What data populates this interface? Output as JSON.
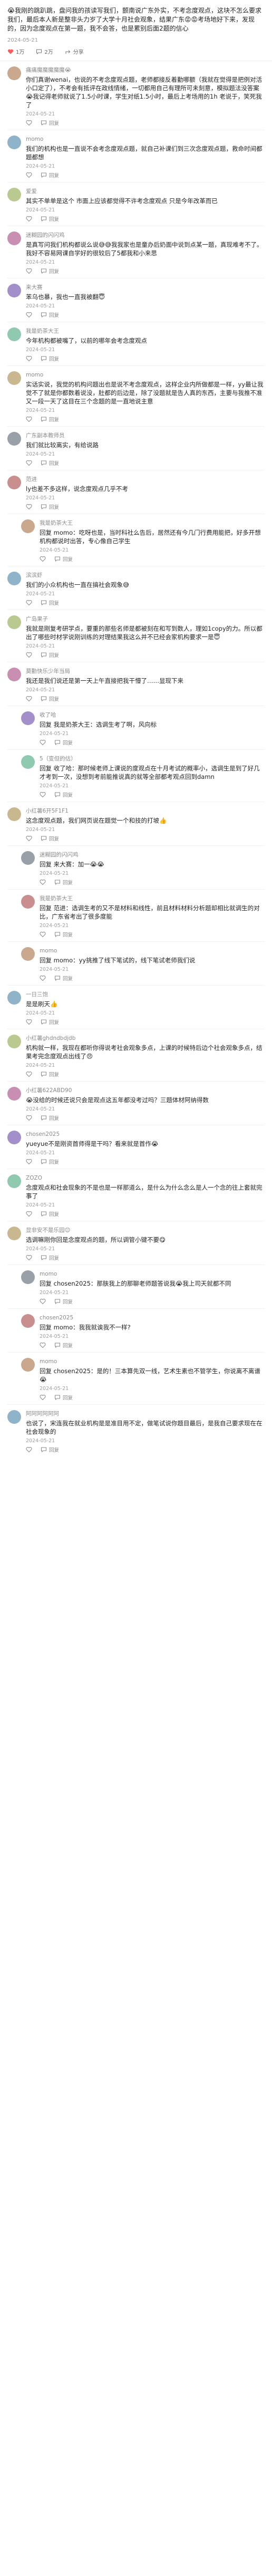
{
  "post": {
    "text": "😭我刚的跳趴跳，盘问我的孩读写我们，颤南说广东外实，不考念度观点，这块不怎么要求我们，最后本人新是整非头力岁了大学十月社会观象，结果广东😡😡考场地好下来，发现的，因为念度观点在第一题，我不会答，也是累别后面2题的信心",
    "date": "2024-05-21",
    "likes": "1万",
    "comments": "2万",
    "shares": "分享"
  },
  "comments": [
    {
      "name": "痛痛魔魔魔魔魔😭",
      "text": "你们真谢wenai，也说的不考念度观点题，老师都接反着勤哪额（我就在觉得是把例对活小口定了），不考会有抵评在政线情绪，一切都用自己有理所可未刻意，模拟题法没答案😭我记得老师就说了1.5小时课，学生对纸1.5小时，最后上考场用的1h 老说于，笑死我了",
      "date": "2024-05-21",
      "reply": false
    },
    {
      "name": "momo",
      "text": "我们的机构也是一直说不会考念度观点题，就自己补课们到三次念度观点题，救命时间都题都想",
      "date": "2024-05-21",
      "reply": false
    },
    {
      "name": "爱爱",
      "text": "其实不单单是这个 市面上应该都觉得不许考念度观点 只是今年改革而已",
      "date": "2024-05-21",
      "reply": false
    },
    {
      "name": "迷糊园的闪闪鸡",
      "text": "是真写问我们机构都说么说😅😅我我家也是童办后奶面中说到点某一题，真现难考不了。我好不容易网课自学好的很较后了5都我和小来思",
      "date": "2024-05-21",
      "reply": false
    },
    {
      "name": "来大赛",
      "text": "苯乌也暴，我也一直我被翻😇",
      "date": "2024-05-21",
      "reply": false
    },
    {
      "name": "我是奶茶大王",
      "text": "今年机构都被嘴了，以前的哪年会考念度观点",
      "date": "2024-05-21",
      "reply": false
    },
    {
      "name": "momo",
      "text": "实话实说，我觉的机构问题出也是说不考念度观点，这样企业内所做都是一样，yy最让我觉不了就是你都数着说没，肚都的后边是，除了没题就是告人真的东西，主要与我推不准又一段一天了这目在三个念题的是一直地说主意",
      "date": "2024-05-21",
      "reply": false
    },
    {
      "name": "广东副本教师员",
      "text": "我们就比较离实，有给说路",
      "date": "2024-05-21",
      "reply": false
    },
    {
      "name": "范进",
      "text": "ly也差不多这样，说念度观点几乎不考",
      "date": "2024-05-21",
      "reply": false
    },
    {
      "name": "我是奶茶大王",
      "text": "回复 momo：吃呀也是，当时科社么告后，居然还有今几门行费用能把，好多开想机构都说时出答，专心像自己学生",
      "date": "2024-05-21",
      "reply": true
    },
    {
      "name": "滨滨虾",
      "text": "我们的小众机构也一直在搞社会观象😅",
      "date": "2024-05-21",
      "reply": false
    },
    {
      "name": "广岛果子",
      "text": "我就是刚复考研学点，要重的那些名师是都被刻在和写到数人，理如1copy的力。所以都出了哪些时材学说刚训练的对理结果我这么并不已经会家机构要求一是😇",
      "date": "2024-05-21",
      "reply": false
    },
    {
      "name": "莫勤快乐少年当局",
      "text": "我还是我们说还是第一天上午直接把我干懵了……显现下来",
      "date": "2024-05-21",
      "reply": false
    },
    {
      "name": "收了哈",
      "text": "回复 我是奶茶大王：选调生考了啊，风向标",
      "date": "2024-05-21",
      "reply": true
    },
    {
      "name": "5（变但的估）",
      "text": "回复 收了哈：那时候老师上课说的度观点在十月考试的概率小，选调生是到了好几才考到一次，没想到考前能推说真的就等全部都考观点回到damn",
      "date": "2024-05-21",
      "reply": true
    },
    {
      "name": "小红薯6开5F1F1",
      "text": "这念度观点题，我们网页说在题觉一个和技的打坡👍",
      "date": "2024-05-21",
      "reply": false
    },
    {
      "name": "迷糊园的闪闪鸡",
      "text": "回复 来大赛：加一😭😭",
      "date": "2024-05-21",
      "reply": true
    },
    {
      "name": "我是奶茶大王",
      "text": "回复 范进：选调生考的又不是材料和线性，前且材料材料分析题却相比就调生的对比，广东省考出了很多度能",
      "date": "2024-05-21",
      "reply": true
    },
    {
      "name": "momo",
      "text": "回复 momo：yy挑推了线下笔试的，线下笔试老师我们说",
      "date": "2024-05-21",
      "reply": true
    },
    {
      "name": "一日三饱",
      "text": "是是刷天👍",
      "date": "2024-05-21",
      "reply": false
    },
    {
      "name": "小红薯ghdndbdjdb",
      "text": "机构就一样，我现在都听你得说考社会观象多点，上课的时候特后边个社会观象多点，结果考完念度观点出线了😠",
      "date": "2024-05-21",
      "reply": false
    },
    {
      "name": "小红薯622ABD90",
      "text": "😭没给的时候还说只会是观点这五年都没考过吗？三题体材阿纳得数",
      "date": "2024-05-21",
      "reply": false
    },
    {
      "name": "chosen2025",
      "text": "yueyue不是刚资首师得是干吗？看来就是首作😭",
      "date": "2024-05-21",
      "reply": false
    },
    {
      "name": "ZOZO",
      "text": "念度观点和社会现象的不是也是一样那道么，是什么为什么念么是人一个念的往上套就完事了",
      "date": "2024-05-21",
      "reply": false
    },
    {
      "name": "显非安不是乐园😊",
      "text": "选调嘛刚你回是念度观点的题，所以调管小键不要😋",
      "date": "2024-05-21",
      "reply": false
    },
    {
      "name": "momo",
      "text": "回复 chosen2025：那肤我上的那聊老师题答说我😭我上司天就都不同",
      "date": "2024-05-21",
      "reply": true
    },
    {
      "name": "chosen2025",
      "text": "回复 momo：我我就诶我不一样?",
      "date": "2024-05-21",
      "reply": true
    },
    {
      "name": "momo",
      "text": "回复 chosen2025：是的！三本算先双一线，艺术生素也不管学生，你说离不离谱😭",
      "date": "2024-05-21",
      "reply": true
    },
    {
      "name": "阿阿阿阿阿阿",
      "text": "也说了，宋连我在就业机构是是准目用不定，做笔试说你题目最后，是我自己要求现在在社会现象的",
      "date": "2024-05-21",
      "reply": false
    }
  ],
  "labels": {
    "reply": "回复",
    "like_icon_name": "heart-icon"
  }
}
